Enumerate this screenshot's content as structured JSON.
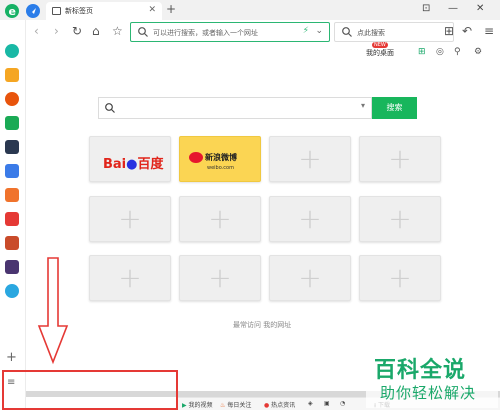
{
  "tab": {
    "title": "新标签页",
    "close": "✕",
    "new_tab": "+"
  },
  "window": {
    "pin": "⊡",
    "minimize": "—",
    "close": "✕"
  },
  "toolbar": {
    "back": "‹",
    "forward": "›",
    "reload": "↻",
    "home": "⌂",
    "star": "☆",
    "omnibox_placeholder": "可以进行搜索，或者输入一个网址",
    "side_search_placeholder": "点此搜索",
    "grid": "⊞",
    "undo": "↶",
    "menu": "≡"
  },
  "page_tools": {
    "desk_label": "我的桌面",
    "new_badge": "NEW",
    "grid": "⊞",
    "palette": "◎",
    "search": "⚲",
    "settings": "⚙"
  },
  "search": {
    "button_label": "搜索",
    "caret": "▾"
  },
  "tiles": {
    "baidu": {
      "text_a": "Bai",
      "paw": "🐾",
      "text_b": "百度"
    },
    "weibo": {
      "name": "新浪微博",
      "url": "weibo.com"
    },
    "plus": "+"
  },
  "recent": "最常访问  我的网址",
  "sidebar": {
    "plus": "+",
    "menu": "≡"
  },
  "statusbar": {
    "video": "我的视频",
    "today": "每日关注",
    "hot": "热点资讯",
    "download": "下载"
  },
  "watermark": {
    "line1": "百科全说",
    "line2": "助你轻松解决"
  },
  "colors": {
    "accent": "#18b65c",
    "annotation": "#e53935",
    "watermark": "#1aa86a"
  }
}
